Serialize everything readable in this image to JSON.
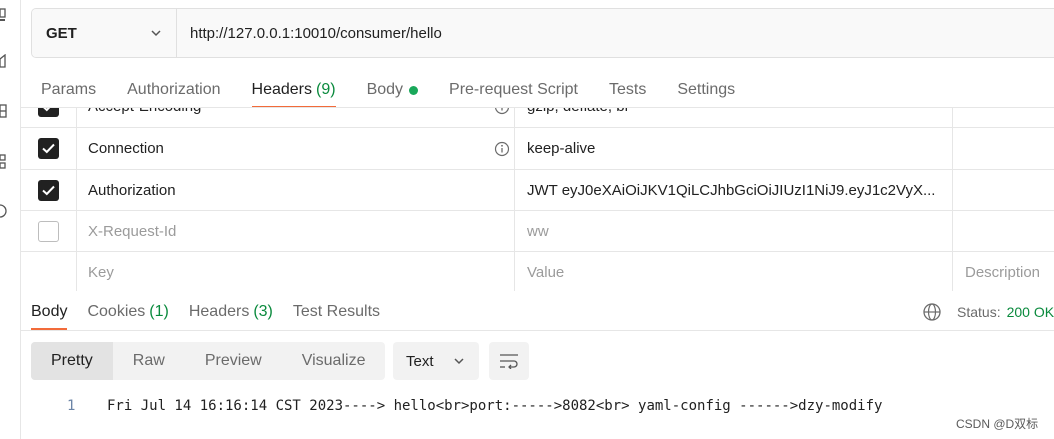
{
  "request": {
    "method": "GET",
    "url": "http://127.0.0.1:10010/consumer/hello"
  },
  "request_tabs": [
    {
      "label": "Params",
      "count": ""
    },
    {
      "label": "Authorization",
      "count": ""
    },
    {
      "label": "Headers",
      "count": "(9)"
    },
    {
      "label": "Body",
      "count": ""
    },
    {
      "label": "Pre-request Script",
      "count": ""
    },
    {
      "label": "Tests",
      "count": ""
    },
    {
      "label": "Settings",
      "count": ""
    }
  ],
  "headers_table": {
    "partial_row": {
      "key": "Accept-Encoding",
      "value": "gzip, deflate, br"
    },
    "rows": [
      {
        "key": "Connection",
        "value": "keep-alive",
        "checked": true
      },
      {
        "key": "Authorization",
        "value": "JWT eyJ0eXAiOiJKV1QiLCJhbGciOiJIUzI1NiJ9.eyJ1c2VyX...",
        "checked": true
      },
      {
        "key": "X-Request-Id",
        "value": "ww",
        "checked": false
      }
    ],
    "placeholder": {
      "key": "Key",
      "value": "Value",
      "description": "Description"
    }
  },
  "response_tabs": [
    {
      "label": "Body",
      "count": ""
    },
    {
      "label": "Cookies",
      "count": "(1)"
    },
    {
      "label": "Headers",
      "count": "(3)"
    },
    {
      "label": "Test Results",
      "count": ""
    }
  ],
  "status": {
    "label": "Status:",
    "code": "200 OK"
  },
  "view_modes": [
    "Pretty",
    "Raw",
    "Preview",
    "Visualize"
  ],
  "format": "Text",
  "response_body": {
    "line_number": "1",
    "text": "Fri Jul 14 16:16:14 CST 2023----> hello<br>port:----->8082<br> yaml-config ------>dzy-modify"
  },
  "watermark": "CSDN @D双标",
  "colors": {
    "accent": "#f26b3a",
    "success": "#0a8a3d",
    "dot": "#19a85a"
  }
}
